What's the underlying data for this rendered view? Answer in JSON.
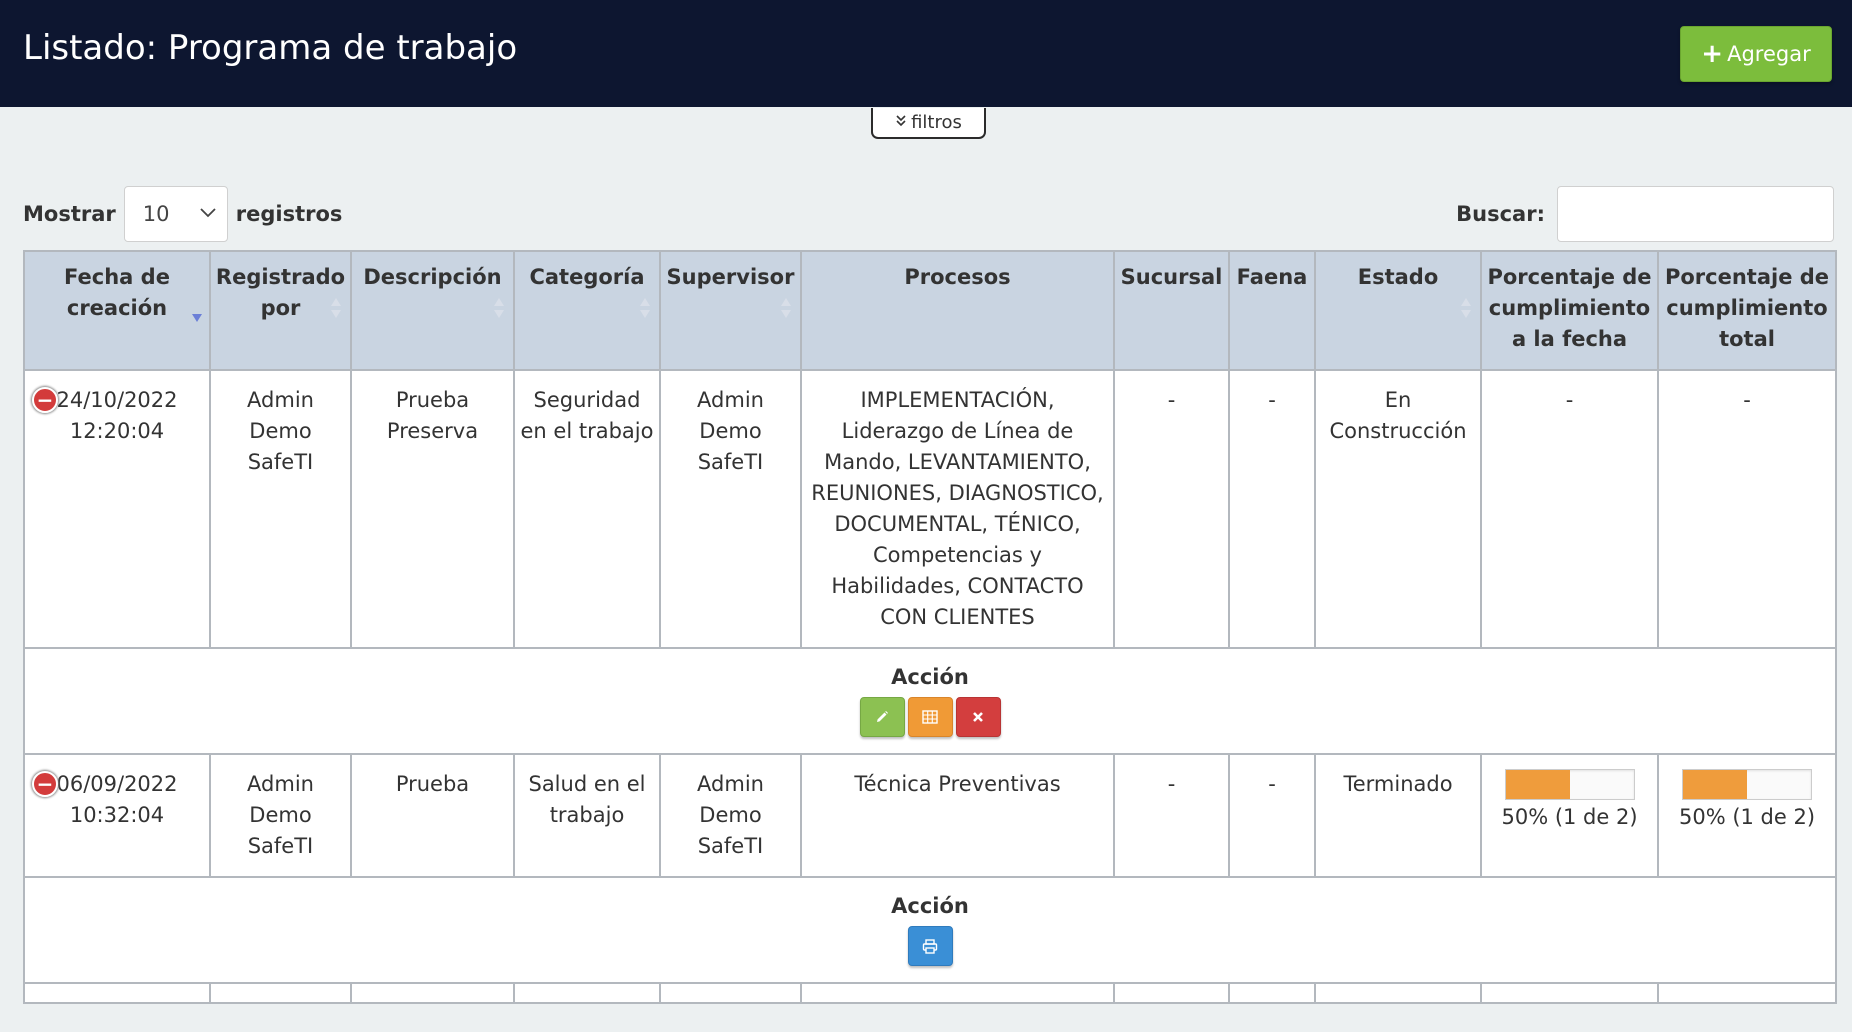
{
  "header": {
    "title": "Listado: Programa de trabajo",
    "add_label": "Agregar"
  },
  "filters": {
    "toggle_label": "filtros"
  },
  "length_control": {
    "prefix": "Mostrar",
    "value": "10",
    "suffix": "registros"
  },
  "search": {
    "label": "Buscar:",
    "value": "",
    "placeholder": ""
  },
  "table": {
    "columns": [
      "Fecha de creación",
      "Registrado por",
      "Descripción",
      "Categoría",
      "Supervisor",
      "Procesos",
      "Sucursal",
      "Faena",
      "Estado",
      "Porcentaje de cumplimiento a la fecha",
      "Porcentaje de cumplimiento total"
    ],
    "sorted_column": "Fecha de creación",
    "sort_direction": "descending",
    "rows": [
      {
        "fecha_date": "24/10/2022",
        "fecha_time": "12:20:04",
        "registrado": "Admin Demo SafeTI",
        "descripcion": "Prueba Preserva",
        "categoria": "Seguridad en el trabajo",
        "supervisor": "Admin Demo SafeTI",
        "procesos": "IMPLEMENTACIÓN, Liderazgo de Línea de Mando, LEVANTAMIENTO, REUNIONES, DIAGNOSTICO, DOCUMENTAL, TÉNICO, Competencias y Habilidades, CONTACTO CON CLIENTES",
        "sucursal": "-",
        "faena": "-",
        "estado": "En Construcción",
        "pct_fecha": "-",
        "pct_total": "-",
        "action_label": "Acción"
      },
      {
        "fecha_date": "06/09/2022",
        "fecha_time": "10:32:04",
        "registrado": "Admin Demo SafeTI",
        "descripcion": "Prueba",
        "categoria": "Salud en el trabajo",
        "supervisor": "Admin Demo SafeTI",
        "procesos": "Técnica Preventivas",
        "sucursal": "-",
        "faena": "-",
        "estado": "Terminado",
        "pct_fecha_text": "50% (1 de 2)",
        "pct_fecha_value": 0.5,
        "pct_total_text": "50% (1 de 2)",
        "pct_total_value": 0.5,
        "action_label": "Acción"
      }
    ]
  },
  "icons": {
    "add": "plus-icon",
    "filters": "double-chevron-down-icon",
    "expand": "minus-circle-icon",
    "edit": "pencil-icon",
    "table": "table-icon",
    "delete": "close-icon",
    "print": "print-icon"
  },
  "colors": {
    "header_bg": "#0d1630",
    "add_button": "#7cbd3c",
    "table_header_bg": "#c9d4e1",
    "edit_button": "#8cc152",
    "table_button": "#f09a36",
    "delete_button": "#d33e3e",
    "print_button": "#3a8fd6",
    "progress_fill": "#ef9c3c",
    "expand_icon": "#d33b3b"
  }
}
